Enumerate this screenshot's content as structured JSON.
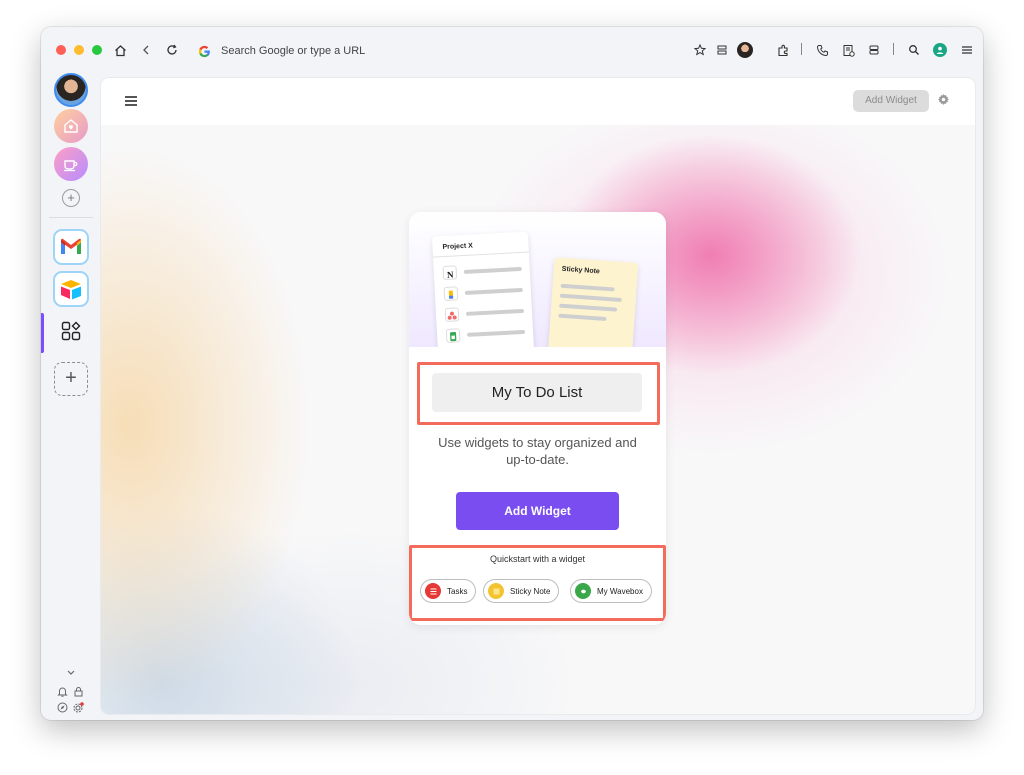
{
  "window": {
    "address_bar": {
      "placeholder": "Search Google or type a URL"
    }
  },
  "sidebar": {
    "spaces": [
      "User profile",
      "Home space",
      "Coffee space"
    ],
    "apps": [
      "Gmail",
      "Airtable",
      "Widgets"
    ]
  },
  "main": {
    "header": {
      "add_widget_label": "Add Widget"
    },
    "card": {
      "illustration": {
        "project_title": "Project X",
        "sticky_title": "Sticky Note"
      },
      "title": "My To Do List",
      "description": "Use widgets to stay organized and up-to-date.",
      "add_widget_label": "Add Widget",
      "quickstart_label": "Quickstart with a widget",
      "chips": [
        {
          "label": "Tasks",
          "color": "#e53935"
        },
        {
          "label": "Sticky Note",
          "color": "#f4c430"
        },
        {
          "label": "My Wavebox",
          "color": "#3aa84a"
        }
      ]
    }
  },
  "colors": {
    "accent": "#7a4df0",
    "highlight": "#f26b5b",
    "active_indicator": "#7b4dff"
  }
}
